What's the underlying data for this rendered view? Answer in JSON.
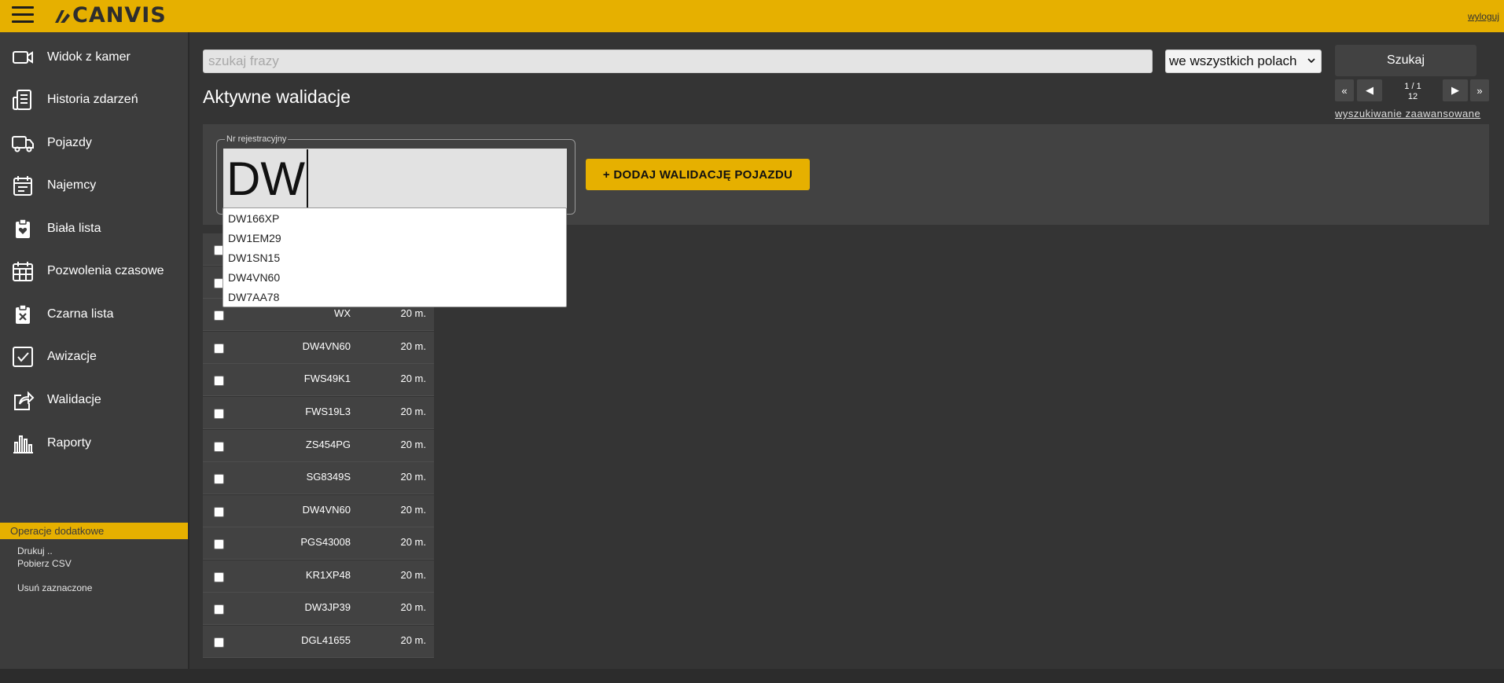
{
  "header": {
    "logo_text": "CANVIS",
    "logout_label": "wyloguj"
  },
  "sidebar": {
    "items": [
      {
        "label": "Widok z kamer",
        "icon": "camera-icon"
      },
      {
        "label": "Historia zdarzeń",
        "icon": "history-document-icon"
      },
      {
        "label": "Pojazdy",
        "icon": "truck-icon"
      },
      {
        "label": "Najemcy",
        "icon": "calendar-notes-icon"
      },
      {
        "label": "Biała lista",
        "icon": "clipboard-heart-icon"
      },
      {
        "label": "Pozwolenia czasowe",
        "icon": "calendar-grid-icon"
      },
      {
        "label": "Czarna lista",
        "icon": "clipboard-x-icon"
      },
      {
        "label": "Awizacje",
        "icon": "checkbox-icon"
      },
      {
        "label": "Walidacje",
        "icon": "share-icon"
      },
      {
        "label": "Raporty",
        "icon": "bar-chart-icon"
      }
    ],
    "ops": {
      "header": "Operacje dodatkowe",
      "print": "Drukuj ..",
      "csv": "Pobierz CSV",
      "delete": "Usuń zaznaczone"
    }
  },
  "search": {
    "placeholder": "szukaj frazy",
    "scope": "we wszystkich polach",
    "button": "Szukaj",
    "advanced": "wyszukiwanie zaawansowane"
  },
  "pagination": {
    "first": "«",
    "prev": "◀",
    "next": "▶",
    "last": "»",
    "pages": "1 / 1",
    "count": "12"
  },
  "page_title": "Aktywne walidacje",
  "filter": {
    "legend": "Nr rejestracyjny",
    "value": "DW",
    "add_button": "+ DODAJ WALIDACJĘ POJAZDU"
  },
  "autocomplete": [
    "DW166XP",
    "DW1EM29",
    "DW1SN15",
    "DW4VN60",
    "DW7AA78"
  ],
  "rows": [
    {
      "plate": "",
      "duration": ""
    },
    {
      "plate": "",
      "duration": ""
    },
    {
      "plate": "WX",
      "duration": "20 m."
    },
    {
      "plate": "DW4VN60",
      "duration": "20 m."
    },
    {
      "plate": "FWS49K1",
      "duration": "20 m."
    },
    {
      "plate": "FWS19L3",
      "duration": "20 m."
    },
    {
      "plate": "ZS454PG",
      "duration": "20 m."
    },
    {
      "plate": "SG8349S",
      "duration": "20 m."
    },
    {
      "plate": "DW4VN60",
      "duration": "20 m."
    },
    {
      "plate": "PGS43008",
      "duration": "20 m."
    },
    {
      "plate": "KR1XP48",
      "duration": "20 m."
    },
    {
      "plate": "DW3JP39",
      "duration": "20 m."
    },
    {
      "plate": "DGL41655",
      "duration": "20 m."
    }
  ]
}
